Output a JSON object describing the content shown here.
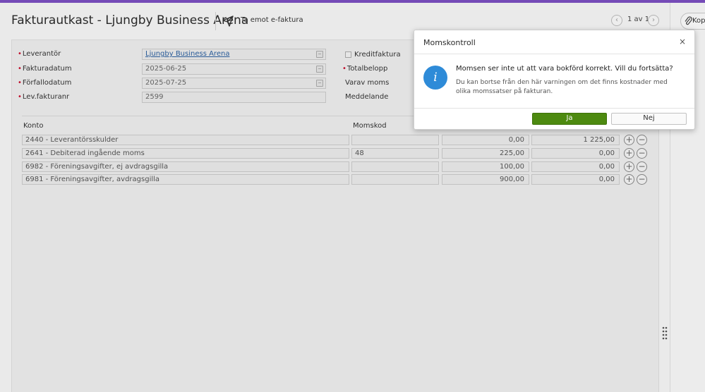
{
  "header": {
    "title": "Fakturautkast - Ljungby Business Arena",
    "send_label": "Ta emot e-faktura",
    "pager": "1 av 1",
    "prev_icon": "chevron-left-icon",
    "next_icon": "chevron-right-icon"
  },
  "side_panel": {
    "attach_label": "Kop"
  },
  "form": {
    "supplier_label": "Leverantör",
    "supplier_value": "Ljungby Business Arena",
    "invoice_date_label": "Fakturadatum",
    "invoice_date_value": "2025-06-25",
    "due_date_label": "Förfallodatum",
    "due_date_value": "2025-07-25",
    "supplier_invoice_no_label": "Lev.fakturanr",
    "supplier_invoice_no_value": "2599",
    "credit_invoice_label": "Kreditfaktura",
    "total_label": "Totalbelopp",
    "vat_label": "Varav moms",
    "message_label": "Meddelande"
  },
  "table": {
    "col_account": "Konto",
    "col_vatcode": "Momskod",
    "rows": [
      {
        "account": "2440 - Leverantörsskulder",
        "vatcode": "",
        "debit": "0,00",
        "credit": "1 225,00"
      },
      {
        "account": "2641 - Debiterad ingående moms",
        "vatcode": "48",
        "debit": "225,00",
        "credit": "0,00"
      },
      {
        "account": "6982 - Föreningsavgifter, ej avdragsgilla",
        "vatcode": "",
        "debit": "100,00",
        "credit": "0,00"
      },
      {
        "account": "6981 - Föreningsavgifter, avdragsgilla",
        "vatcode": "",
        "debit": "900,00",
        "credit": "0,00"
      }
    ]
  },
  "dialog": {
    "title": "Momskontroll",
    "message": "Momsen ser inte ut att vara bokförd korrekt. Vill du fortsätta?",
    "detail": "Du kan bortse från den här varningen om det finns kostnader med olika momssatser på fakturan.",
    "yes_label": "Ja",
    "no_label": "Nej",
    "close_glyph": "×",
    "info_glyph": "i"
  },
  "colors": {
    "accent_bar": "#7a4fbf",
    "yes_button": "#4d8a10",
    "info_icon": "#2e8bd8",
    "link": "#2a5e9e",
    "required_marker": "#c8102e"
  }
}
